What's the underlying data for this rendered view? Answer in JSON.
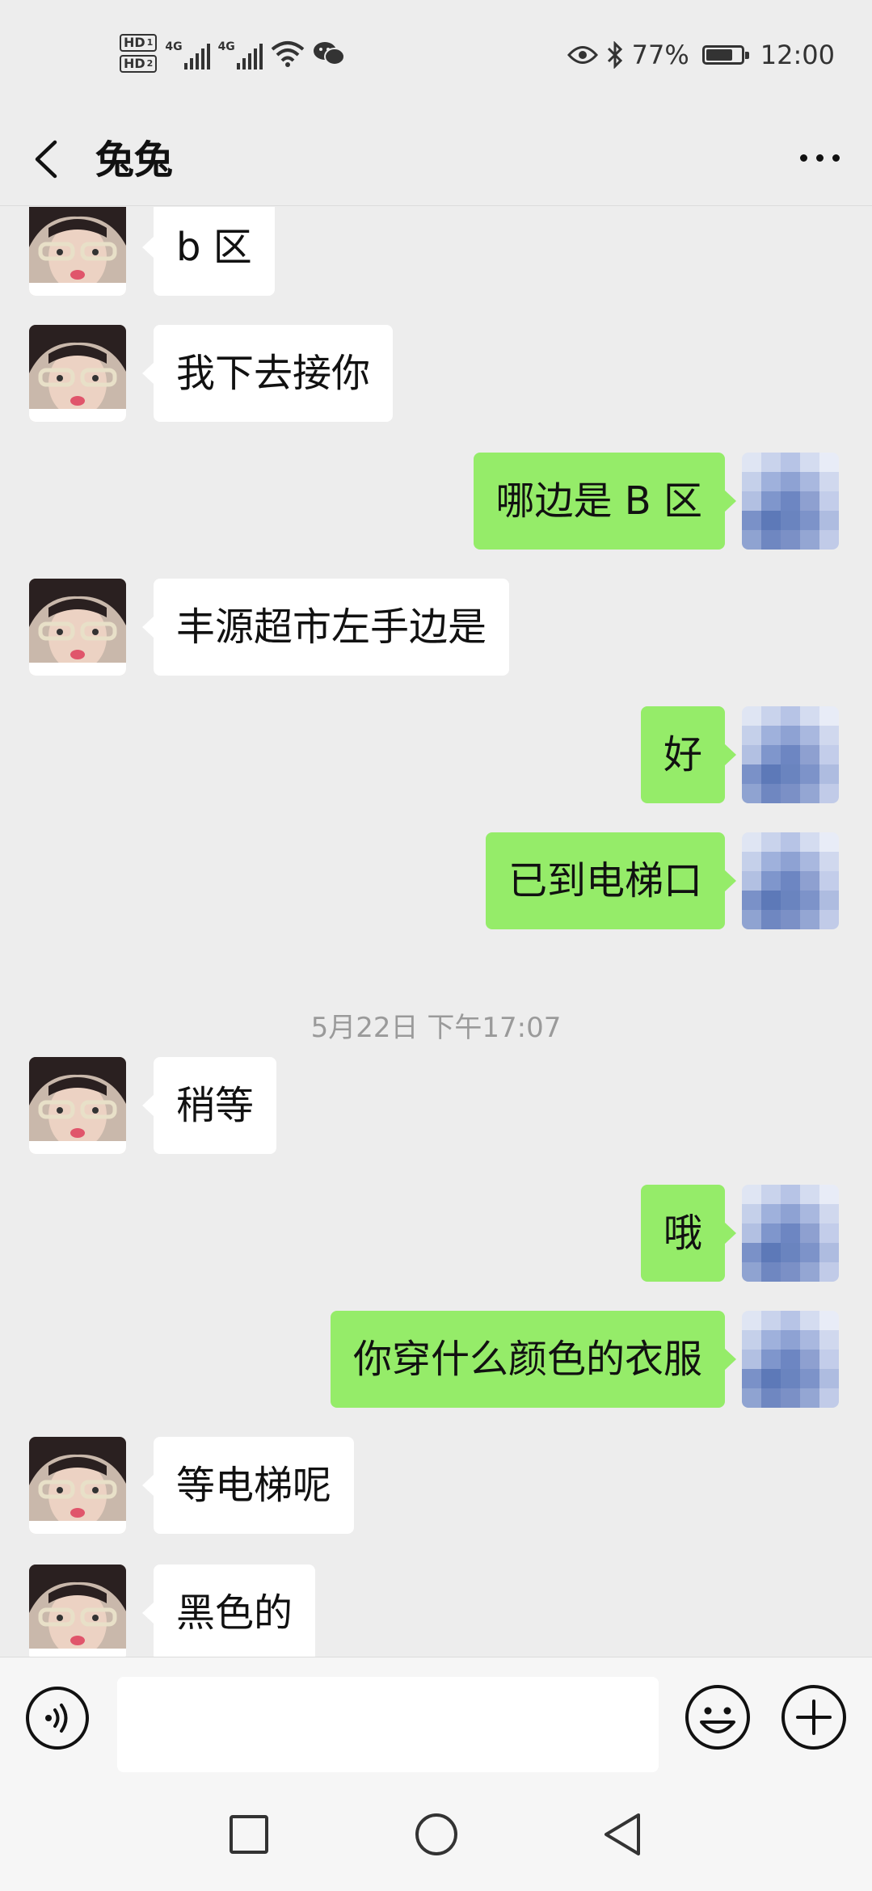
{
  "status_bar": {
    "hd1": "HD",
    "hd1_sub": "1",
    "hd2": "HD",
    "hd2_sub": "2",
    "net1": "4G",
    "net2": "4G",
    "battery_percent": "77%",
    "battery_level": 0.77,
    "time": "12:00",
    "icons": [
      "signal-icon",
      "wifi-icon",
      "wechat-icon",
      "eye-icon",
      "bluetooth-icon",
      "battery-icon"
    ]
  },
  "header": {
    "title": "兔兔",
    "back_icon": "chevron-left-icon",
    "more_icon": "more-dots-icon"
  },
  "messages": [
    {
      "side": "in",
      "text": "b 区"
    },
    {
      "side": "in",
      "text": "我下去接你"
    },
    {
      "side": "out",
      "text": "哪边是 B 区"
    },
    {
      "side": "in",
      "text": "丰源超市左手边是"
    },
    {
      "side": "out",
      "text": "好"
    },
    {
      "side": "out",
      "text": "已到电梯口"
    },
    {
      "side": "time",
      "text": "5月22日 下午17:07"
    },
    {
      "side": "in",
      "text": "稍等"
    },
    {
      "side": "out",
      "text": "哦"
    },
    {
      "side": "out",
      "text": "你穿什么颜色的衣服"
    },
    {
      "side": "in",
      "text": "等电梯呢"
    },
    {
      "side": "in",
      "text": "黑色的"
    }
  ],
  "input_bar": {
    "placeholder": "",
    "voice_icon": "voice-icon",
    "emoji_icon": "emoji-icon",
    "plus_icon": "plus-icon"
  },
  "nav_bar": {
    "icons": [
      "recent-apps-icon",
      "home-icon",
      "back-triangle-icon"
    ]
  },
  "colors": {
    "background": "#ededed",
    "outgoing_bubble": "#95ec69",
    "incoming_bubble": "#ffffff",
    "timestamp_text": "#9a9a9a"
  }
}
